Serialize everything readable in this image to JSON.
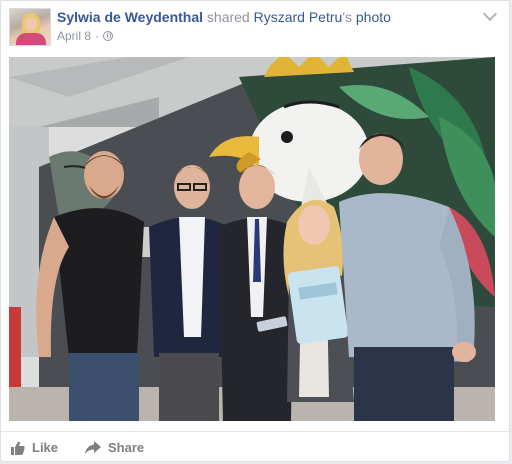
{
  "post": {
    "author_name": "Sylwia de Weydenthal",
    "action_text": "shared",
    "shared_owner": "Ryszard Petru",
    "possessive": "'s",
    "object_text": "photo",
    "date": "April 8",
    "privacy_icon": "globe-icon",
    "menu_icon": "chevron-down-icon"
  },
  "actions": {
    "like_label": "Like",
    "share_label": "Share"
  },
  "colors": {
    "link": "#365899",
    "meta": "#90949c",
    "action": "#7f7f7f"
  }
}
